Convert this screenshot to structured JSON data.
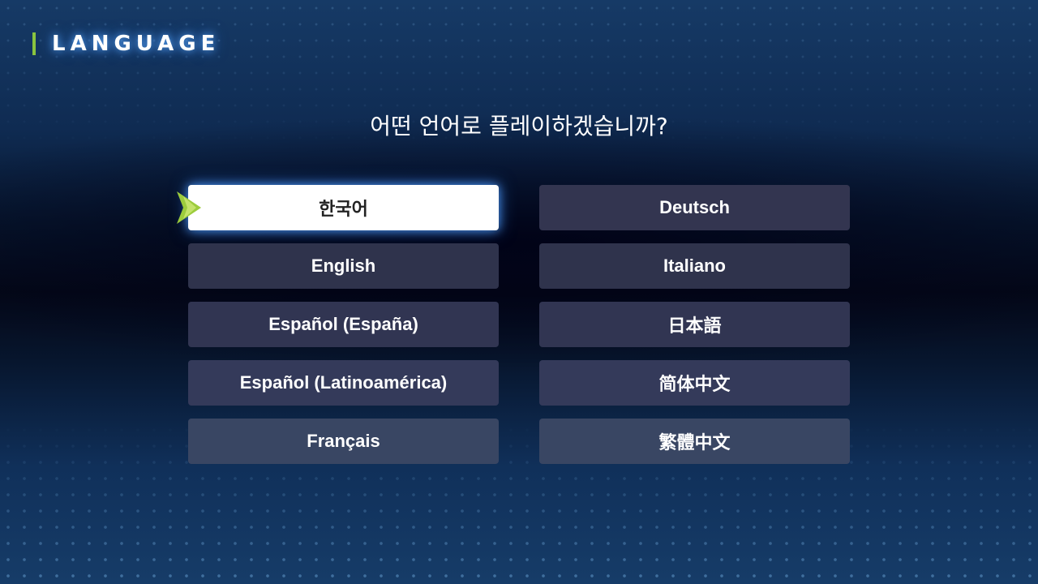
{
  "header": {
    "title": "LANGUAGE"
  },
  "prompt": "어떤 언어로 플레이하겠습니까?",
  "languages": {
    "left": [
      {
        "label": "한국어",
        "selected": true
      },
      {
        "label": "English",
        "selected": false
      },
      {
        "label": "Español (España)",
        "selected": false
      },
      {
        "label": "Español (Latinoamérica)",
        "selected": false
      },
      {
        "label": "Français",
        "selected": false
      }
    ],
    "right": [
      {
        "label": "Deutsch",
        "selected": false
      },
      {
        "label": "Italiano",
        "selected": false
      },
      {
        "label": "日本語",
        "selected": false
      },
      {
        "label": "简体中文",
        "selected": false
      },
      {
        "label": "繁體中文",
        "selected": false
      }
    ]
  },
  "icons": {
    "selection_cursor": "chevron-right-icon"
  },
  "colors": {
    "accent_green": "#8ac43f",
    "button_bg": "#333550",
    "selected_bg": "#ffffff",
    "glow_blue": "#50a0ff"
  }
}
